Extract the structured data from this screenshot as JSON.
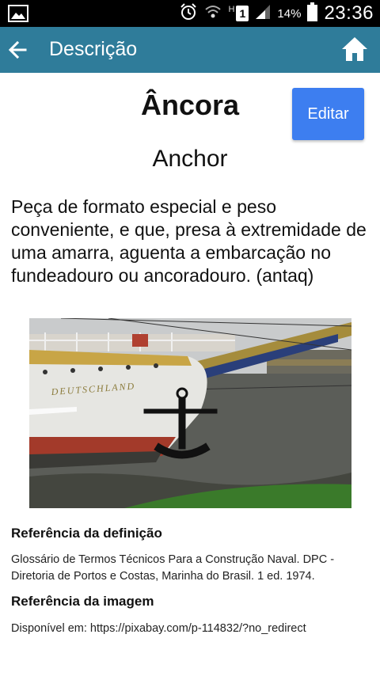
{
  "status_bar": {
    "network_label": "H",
    "sim_label": "1",
    "battery_percent": "14%",
    "time": "23:36"
  },
  "app_bar": {
    "title": "Descrição",
    "back_icon": "arrow-left-icon",
    "home_icon": "home-icon"
  },
  "entry": {
    "title": "Âncora",
    "edit_label": "Editar",
    "translation": "Anchor",
    "definition": "Peça de formato especial e peso conveniente, e que, presa à extremidade de uma amarra, aguenta a embarcação no fundeadouro ou ancoradouro. (antaq)",
    "image_hull_text": "DEUTSCHLAND"
  },
  "references": {
    "definition_heading": "Referência da definição",
    "definition_text": "Glossário de Termos Técnicos Para a Construção Naval. DPC - Diretoria de Portos e Costas, Marinha do Brasil. 1 ed. 1974.",
    "image_heading": "Referência da imagem",
    "image_text": "Disponível em: https://pixabay.com/p-114832/?no_redirect"
  },
  "colors": {
    "app_bar": "#2f7c9a",
    "edit_button": "#3d7ef0",
    "status_bar": "#000000"
  }
}
